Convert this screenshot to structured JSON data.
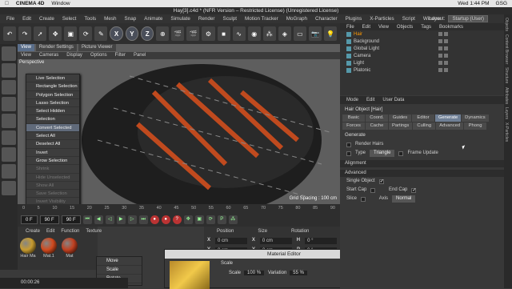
{
  "mac": {
    "apple": "",
    "app": "CINEMA 4D",
    "window": "Window",
    "right": [
      "Wed 1:44 PM",
      "GSG"
    ]
  },
  "title": "Hay[3].c4d * (NFR Version – Restricted License) (Unregistered License)",
  "menu": [
    "File",
    "Edit",
    "Create",
    "Select",
    "Tools",
    "Mesh",
    "Snap",
    "Animate",
    "Simulate",
    "Render",
    "Sculpt",
    "Motion Tracker",
    "MoGraph",
    "Character",
    "Plugins",
    "X-Particles",
    "Script",
    "Window",
    "Help"
  ],
  "layout": {
    "label": "Layout:",
    "value": "Startup (User)"
  },
  "toolbar": {
    "x": "X",
    "y": "Y",
    "z": "Z"
  },
  "viewport": {
    "tabs": [
      "View",
      "Render Settings",
      "Picture Viewer"
    ],
    "menu": [
      "View",
      "Cameras",
      "Display",
      "Options",
      "Filter",
      "Panel"
    ],
    "perspective": "Perspective",
    "grid": "Grid Spacing : 100 cm"
  },
  "context_menu": [
    {
      "label": "Live Selection",
      "state": "normal"
    },
    {
      "label": "Rectangle Selection",
      "state": "normal"
    },
    {
      "label": "Polygon Selection",
      "state": "normal"
    },
    {
      "label": "Lasso Selection",
      "state": "normal"
    },
    {
      "label": "Select Hidden",
      "state": "normal"
    },
    {
      "label": "Selection",
      "state": "normal"
    },
    {
      "label": "Convert Selected",
      "state": "hl"
    },
    {
      "label": "Select All",
      "state": "normal"
    },
    {
      "label": "Deselect All",
      "state": "normal"
    },
    {
      "label": "Invert",
      "state": "normal"
    },
    {
      "label": "Grow Selection",
      "state": "normal"
    },
    {
      "label": "Shrink",
      "state": "dis"
    },
    {
      "label": "Hide Unselected",
      "state": "dis"
    },
    {
      "label": "Show All",
      "state": "dis"
    },
    {
      "label": "Save Selection",
      "state": "dis"
    },
    {
      "label": "Invert Visibility",
      "state": "dis"
    },
    {
      "label": "Unhide Selected",
      "state": "dis"
    },
    {
      "label": "Hide All",
      "state": "dis"
    },
    {
      "label": "Set Selection",
      "state": "dis"
    }
  ],
  "timeline": {
    "ticks": [
      "0",
      "5",
      "10",
      "15",
      "20",
      "25",
      "30",
      "35",
      "40",
      "45",
      "50",
      "55",
      "60",
      "65",
      "70",
      "75",
      "80",
      "85",
      "90"
    ],
    "frame": "0 F",
    "start": "0 F",
    "end": "90 F",
    "end2": "90 F"
  },
  "material_manager": {
    "tabs": [
      "Create",
      "Edit",
      "Function",
      "Texture"
    ],
    "materials": [
      {
        "name": "Hair Ma",
        "color": "#c89c30"
      },
      {
        "name": "Mat.1",
        "color": "#d24a1e"
      },
      {
        "name": "Mat",
        "color": "#c04020"
      }
    ]
  },
  "coords": {
    "headers": [
      "Position",
      "Size",
      "Rotation"
    ],
    "rows": [
      [
        "X",
        "0 cm",
        "X",
        "0 cm",
        "H",
        "0 °"
      ],
      [
        "Y",
        "0 cm",
        "Y",
        "0 cm",
        "P",
        "0 °"
      ]
    ]
  },
  "tools_menu": [
    "Move",
    "Scale",
    "Rotate"
  ],
  "material_editor": {
    "title": "Material Editor",
    "scale_label": "Scale",
    "scale_field_label": "Scale",
    "scale_value": "100 %",
    "variation_label": "Variation",
    "variation_value": "55 %"
  },
  "object_manager": {
    "tabs": [
      "File",
      "Edit",
      "View",
      "Objects",
      "Tags",
      "Bookmarks"
    ],
    "objects": [
      {
        "name": "Hair",
        "sel": true
      },
      {
        "name": "Background",
        "sel": false
      },
      {
        "name": "Global Light",
        "sel": false
      },
      {
        "name": "Camera",
        "sel": false
      },
      {
        "name": "Light",
        "sel": false
      },
      {
        "name": "Platonic",
        "sel": false
      }
    ]
  },
  "attributes": {
    "tabs": [
      "Mode",
      "Edit",
      "User Data"
    ],
    "title": "Hair Object [Hair]",
    "ptabs": [
      {
        "l": "Basic",
        "on": false
      },
      {
        "l": "Coord.",
        "on": false
      },
      {
        "l": "Guides",
        "on": false
      },
      {
        "l": "Editor",
        "on": false
      },
      {
        "l": "Generate",
        "on": true
      },
      {
        "l": "Dynamics",
        "on": false
      },
      {
        "l": "Forces",
        "on": false
      },
      {
        "l": "Cache",
        "on": false
      },
      {
        "l": "Partings",
        "on": false
      },
      {
        "l": "Culling",
        "on": false
      },
      {
        "l": "Advanced",
        "on": false
      },
      {
        "l": "Phong",
        "on": false
      }
    ],
    "section": "Generate",
    "render_hairs": "Render Hairs",
    "type_label": "Type",
    "type_value": "Triangle",
    "frame_update": "Frame Update",
    "alignment": "Alignment",
    "advanced": "Advanced",
    "single_object": "Single Object",
    "start_cap": "Start Cap",
    "end_cap": "End Cap",
    "slice": "Slice",
    "axis": "Axis",
    "axis_value": "Normal"
  },
  "sidebar": [
    "Objects",
    "Content Browser",
    "Structure",
    "Attributes",
    "Layers",
    "X-Particles"
  ],
  "status": "00:00:26"
}
